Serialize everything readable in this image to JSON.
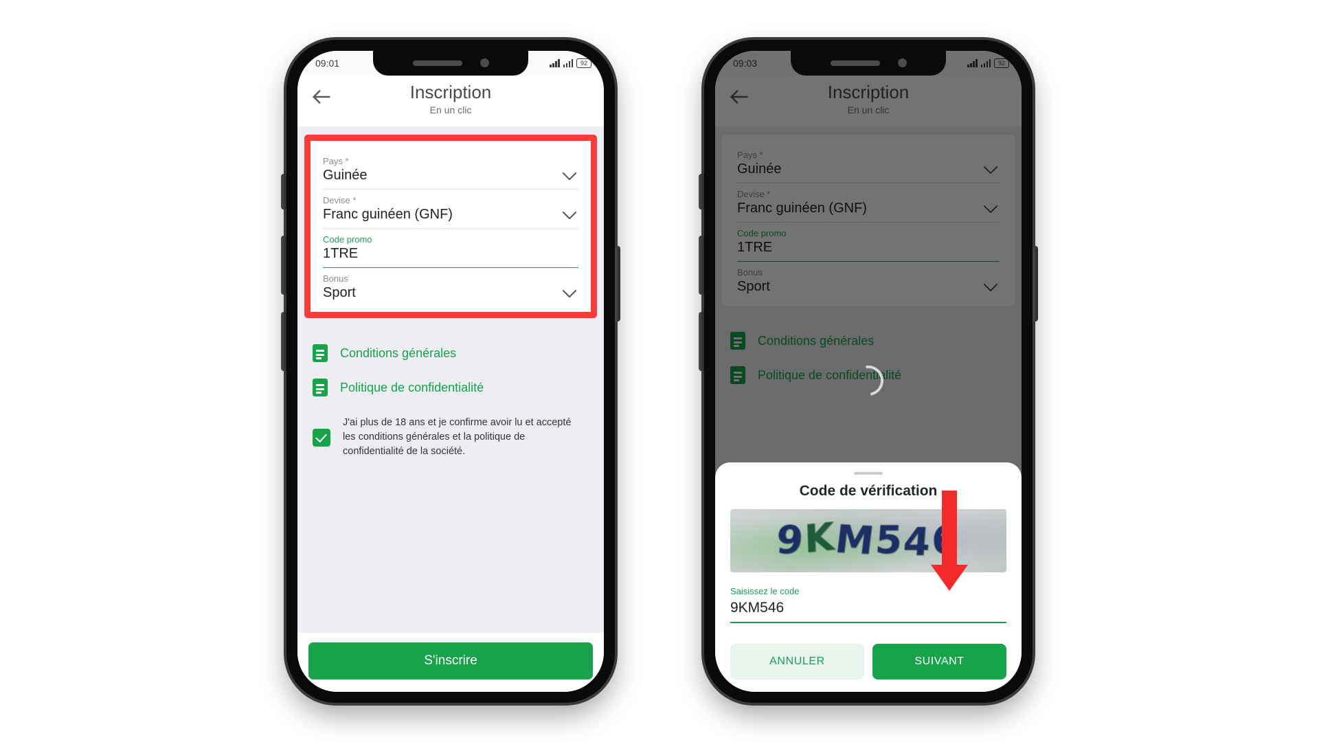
{
  "theme": {
    "brand_green": "#17a34a",
    "label_green": "#1aa055",
    "highlight_red": "#fb3a3a",
    "arrow_red": "#f42a2a",
    "screen_bg": "#eceef2"
  },
  "phone1": {
    "status": {
      "time": "09:01",
      "battery": "92"
    },
    "appbar": {
      "title": "Inscription",
      "subtitle": "En un clic",
      "back_icon": "arrow-left-icon"
    },
    "form": {
      "fields": [
        {
          "label": "Pays *",
          "value": "Guinée",
          "type": "select",
          "accent": false
        },
        {
          "label": "Devise *",
          "value": "Franc guinéen (GNF)",
          "type": "select",
          "accent": false
        },
        {
          "label": "Code promo",
          "value": "1TRE",
          "type": "text",
          "accent": true
        },
        {
          "label": "Bonus",
          "value": "Sport",
          "type": "select",
          "accent": false
        }
      ]
    },
    "links": [
      {
        "label": "Conditions générales",
        "icon": "document-icon"
      },
      {
        "label": "Politique de confidentialité",
        "icon": "document-icon"
      }
    ],
    "consent": {
      "checked": true,
      "text": "J'ai plus de 18 ans et je confirme avoir lu et accepté les conditions générales et la politique de confidentialité de la société."
    },
    "footer": {
      "submit_label": "S'inscrire"
    }
  },
  "phone2": {
    "status": {
      "time": "09:03",
      "battery": "92"
    },
    "appbar": {
      "title": "Inscription",
      "subtitle": "En un clic",
      "back_icon": "arrow-left-icon"
    },
    "form": {
      "fields": [
        {
          "label": "Pays *",
          "value": "Guinée",
          "type": "select",
          "accent": false
        },
        {
          "label": "Devise *",
          "value": "Franc guinéen (GNF)",
          "type": "select",
          "accent": false
        },
        {
          "label": "Code promo",
          "value": "1TRE",
          "type": "text",
          "accent": true
        },
        {
          "label": "Bonus",
          "value": "Sport",
          "type": "select",
          "accent": false
        }
      ]
    },
    "links": [
      {
        "label": "Conditions générales",
        "icon": "document-icon"
      },
      {
        "label": "Politique de confidentialité",
        "icon": "document-icon"
      }
    ],
    "modal": {
      "title": "Code de vérification",
      "captcha_text": "9KM546",
      "input_label": "Saisissez le code",
      "input_value": "9KM546",
      "cancel_label": "ANNULER",
      "next_label": "SUIVANT"
    }
  }
}
